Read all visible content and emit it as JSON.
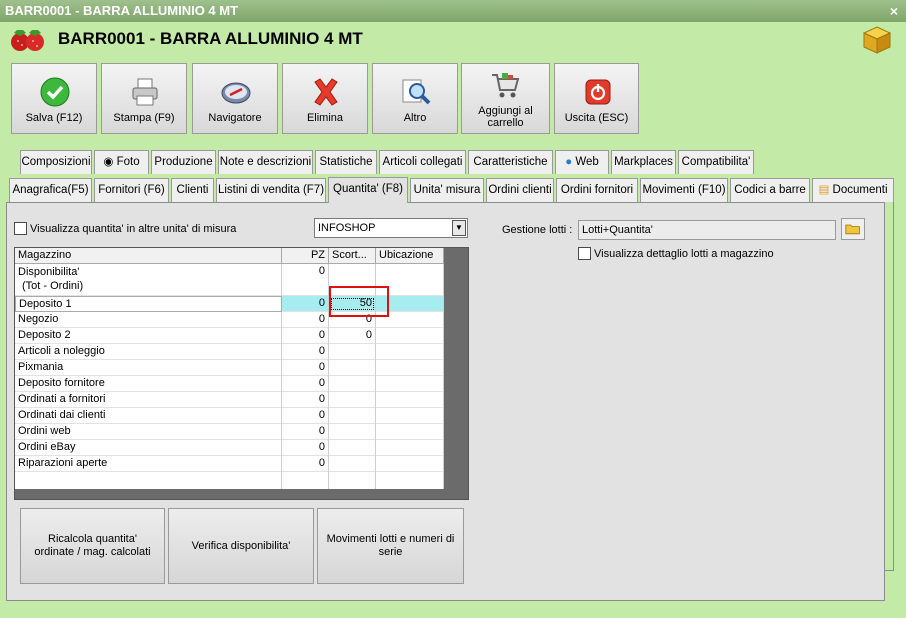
{
  "window": {
    "title": "BARR0001 - BARRA ALLUMINIO 4 MT",
    "close_glyph": "×"
  },
  "header": {
    "title": "BARR0001 - BARRA ALLUMINIO 4 MT"
  },
  "toolbar": [
    {
      "id": "save",
      "label": "Salva (F12)",
      "icon": "check-icon"
    },
    {
      "id": "print",
      "label": "Stampa (F9)",
      "icon": "printer-icon"
    },
    {
      "id": "nav",
      "label": "Navigatore",
      "icon": "compass-icon"
    },
    {
      "id": "delete",
      "label": "Elimina",
      "icon": "x-icon"
    },
    {
      "id": "other",
      "label": "Altro",
      "icon": "magnifier-icon"
    },
    {
      "id": "cart",
      "label": "Aggiungi al carrello",
      "icon": "cart-icon"
    },
    {
      "id": "exit",
      "label": "Uscita (ESC)",
      "icon": "power-icon"
    }
  ],
  "tabs_top": [
    "Composizioni",
    "Foto",
    "Produzione",
    "Note e descrizioni",
    "Statistiche",
    "Articoli collegati",
    "Caratteristiche",
    "Web",
    "Markplaces",
    "Compatibilita'"
  ],
  "tabs_bottom": [
    "Anagrafica(F5)",
    "Fornitori (F6)",
    "Clienti",
    "Listini di vendita (F7)",
    "Quantita' (F8)",
    "Unita' misura",
    "Ordini clienti",
    "Ordini fornitori",
    "Movimenti (F10)",
    "Codici a barre",
    "Documenti"
  ],
  "options": {
    "show_other_units_label": "Visualizza quantita' in altre unita' di misura",
    "store_selected": "INFOSHOP",
    "lot_management_label": "Gestione lotti :",
    "lot_management_value": "Lotti+Quantita'",
    "show_lot_detail_label": "Visualizza dettaglio lotti a magazzino"
  },
  "grid": {
    "headers": [
      "Magazzino",
      "PZ",
      "Scort...",
      "Ubicazione"
    ],
    "rows": [
      {
        "name": "Disponibilita'",
        "name2": "(Tot - Ordini)",
        "pz": "0",
        "scorta": "",
        "ub": ""
      },
      {
        "name": "Deposito 1",
        "pz": "0",
        "scorta": "50",
        "ub": ""
      },
      {
        "name": "Negozio",
        "pz": "0",
        "scorta": "0",
        "ub": ""
      },
      {
        "name": "Deposito 2",
        "pz": "0",
        "scorta": "0",
        "ub": ""
      },
      {
        "name": "Articoli a noleggio",
        "pz": "0",
        "scorta": "",
        "ub": ""
      },
      {
        "name": "Pixmania",
        "pz": "0",
        "scorta": "",
        "ub": ""
      },
      {
        "name": "Deposito fornitore",
        "pz": "0",
        "scorta": "",
        "ub": ""
      },
      {
        "name": "Ordinati a fornitori",
        "pz": "0",
        "scorta": "",
        "ub": ""
      },
      {
        "name": "Ordinati dai clienti",
        "pz": "0",
        "scorta": "",
        "ub": ""
      },
      {
        "name": "Ordini web",
        "pz": "0",
        "scorta": "",
        "ub": ""
      },
      {
        "name": "Ordini eBay",
        "pz": "0",
        "scorta": "",
        "ub": ""
      },
      {
        "name": "Riparazioni aperte",
        "pz": "0",
        "scorta": "",
        "ub": ""
      }
    ]
  },
  "actions": {
    "recalc": "Ricalcola quantita' ordinate / mag. calcolati",
    "verify": "Verifica disponibilita'",
    "lot_moves": "Movimenti lotti e numeri di serie"
  },
  "colors": {
    "accent_green": "#c3eaa6",
    "highlight_row": "#a7ecef",
    "callout_red": "#e01010"
  }
}
